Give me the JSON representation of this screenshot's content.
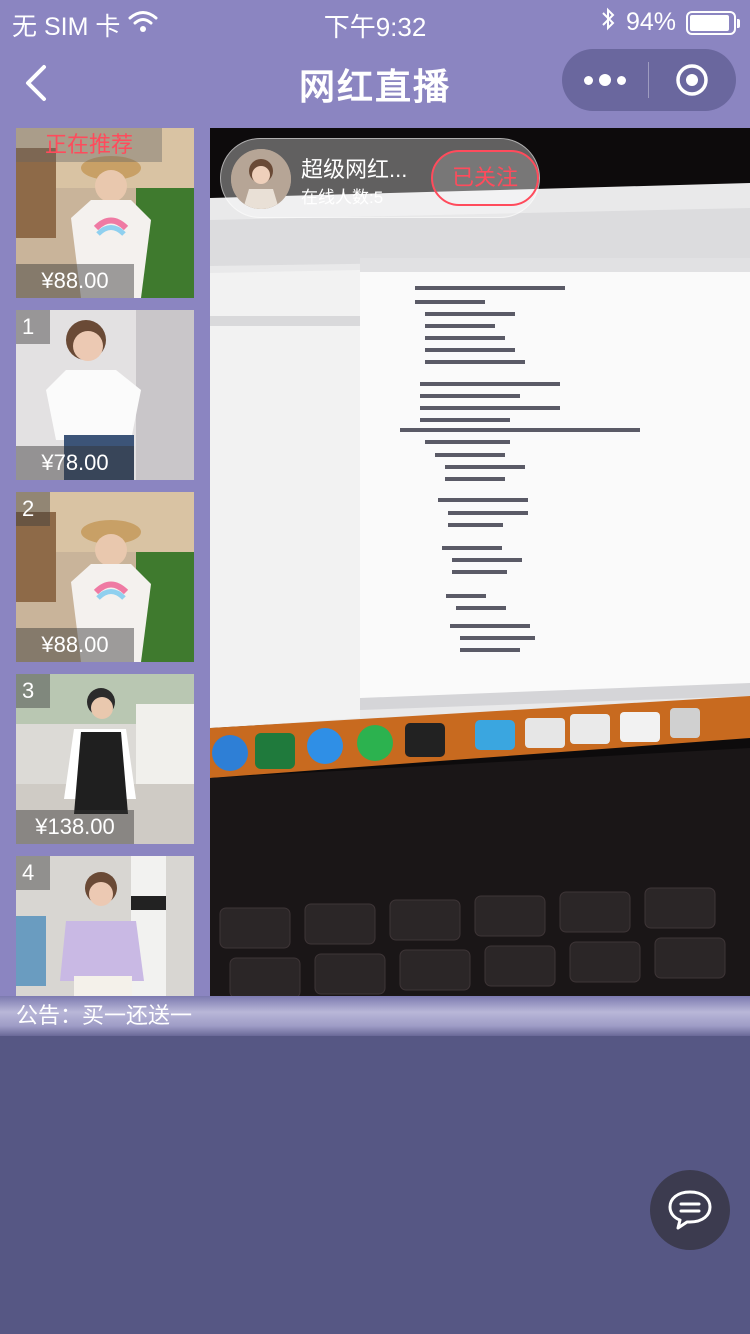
{
  "status_bar": {
    "carrier": "无 SIM 卡",
    "time": "下午9:32",
    "battery": "94%",
    "battery_level": 0.94
  },
  "nav": {
    "title": "网红直播"
  },
  "colors": {
    "header_bg": "#8b85c1",
    "page_bg": "#565784",
    "accent_red": "#ff4b5c"
  },
  "products": [
    {
      "badge": "正在推荐",
      "price": "¥88.00"
    },
    {
      "index": "1",
      "price": "¥78.00"
    },
    {
      "index": "2",
      "price": "¥88.00"
    },
    {
      "index": "3",
      "price": "¥138.00"
    },
    {
      "index": "4",
      "price": ""
    }
  ],
  "anchor": {
    "name": "超级网红...",
    "viewers": "在线人数:5",
    "follow_label": "已关注"
  },
  "announcement": {
    "text": "公告：买一还送一"
  },
  "icons": {
    "back": "chevron-left-icon",
    "more": "more-dots-icon",
    "target": "target-icon",
    "wifi": "wifi-icon",
    "bluetooth": "bluetooth-icon",
    "chat": "chat-bubble-icon"
  }
}
